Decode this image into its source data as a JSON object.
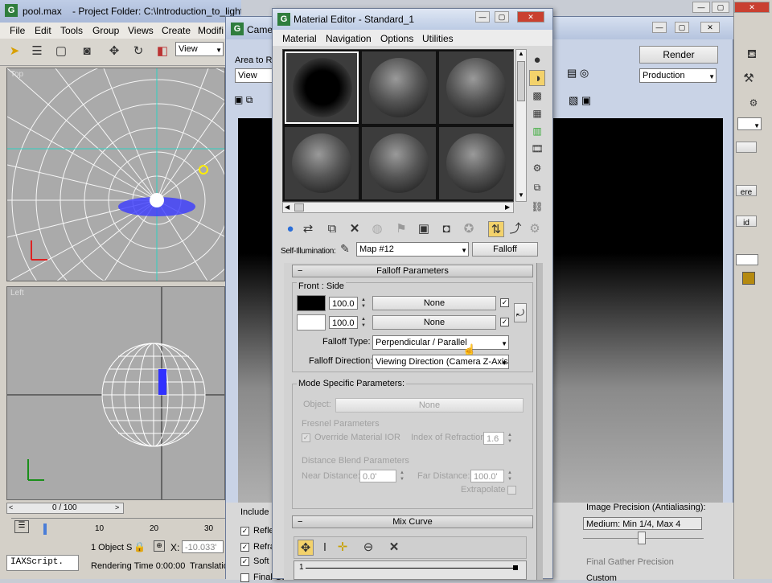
{
  "max": {
    "title": "pool.max",
    "project": "- Project Folder: C:\\Introduction_to_lighting_proje",
    "menu": [
      "File",
      "Edit",
      "Tools",
      "Group",
      "Views",
      "Create",
      "Modifi"
    ],
    "view_dropdown": "View",
    "top_label": "Top",
    "left_label": "Left",
    "frame_counter": "0 / 100",
    "ruler_ticks": [
      "10",
      "20",
      "30"
    ],
    "maxscript": "IAXScript.",
    "object_status": "1 Object S",
    "x_label": "X:",
    "x_value": "-10.033'",
    "render_time": "Rendering Time  0:00:00",
    "translation": "Translatio"
  },
  "cam": {
    "title": "Camera",
    "area_label": "Area to Re",
    "area_value": "View",
    "render_button": "Render",
    "preset": "Production",
    "include_label": "Include",
    "check_items": [
      "Refle",
      "Refra",
      "Soft",
      "Final Gather"
    ],
    "image_precision": "Image Precision (Antialiasing):",
    "precision_value": "Medium: Min 1/4, Max 4",
    "final_gather": "Final Gather Precision",
    "custom": "Custom",
    "side_buttons": [
      "ere",
      "id"
    ]
  },
  "me": {
    "title": "Material Editor - Standard_1",
    "menu": [
      "Material",
      "Navigation",
      "Options",
      "Utilities"
    ],
    "slot_label": "Self-Illumination:",
    "map_name": "Map #12",
    "map_type": "Falloff",
    "rollout_falloff": "Falloff Parameters",
    "front_side": "Front : Side",
    "val1": "100.0",
    "val2": "100.0",
    "none1": "None",
    "none2": "None",
    "falloff_type_label": "Falloff Type:",
    "falloff_type": "Perpendicular / Parallel",
    "falloff_dir_label": "Falloff Direction:",
    "falloff_dir": "Viewing Direction (Camera Z-Axis)",
    "mode_specific": "Mode Specific Parameters:",
    "object_label": "Object:",
    "object_none": "None",
    "fresnel_params": "Fresnel Parameters",
    "override_ior": "Override Material IOR",
    "ior_label": "Index of Refraction",
    "ior_value": "1.6",
    "distance_blend": "Distance Blend Parameters",
    "near_label": "Near Distance:",
    "near_value": "0.0'",
    "far_label": "Far Distance:",
    "far_value": "100.0'",
    "extrapolate": "Extrapolate",
    "rollout_mix": "Mix Curve"
  }
}
